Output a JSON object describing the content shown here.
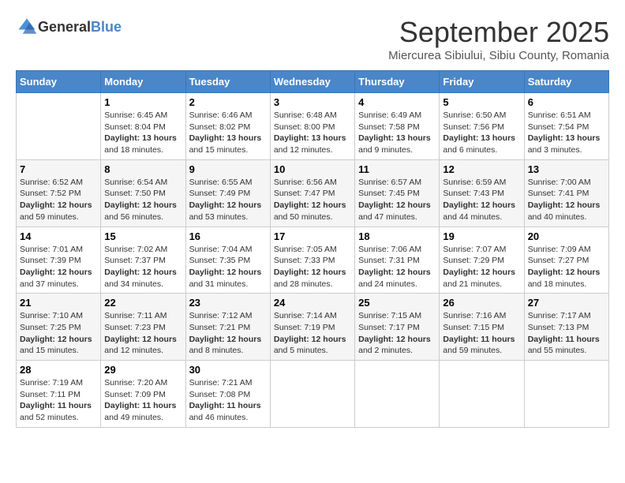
{
  "header": {
    "logo_general": "General",
    "logo_blue": "Blue",
    "month": "September 2025",
    "location": "Miercurea Sibiului, Sibiu County, Romania"
  },
  "weekdays": [
    "Sunday",
    "Monday",
    "Tuesday",
    "Wednesday",
    "Thursday",
    "Friday",
    "Saturday"
  ],
  "weeks": [
    [
      {
        "day": "",
        "info": ""
      },
      {
        "day": "1",
        "info": "Sunrise: 6:45 AM\nSunset: 8:04 PM\nDaylight: 13 hours\nand 18 minutes."
      },
      {
        "day": "2",
        "info": "Sunrise: 6:46 AM\nSunset: 8:02 PM\nDaylight: 13 hours\nand 15 minutes."
      },
      {
        "day": "3",
        "info": "Sunrise: 6:48 AM\nSunset: 8:00 PM\nDaylight: 13 hours\nand 12 minutes."
      },
      {
        "day": "4",
        "info": "Sunrise: 6:49 AM\nSunset: 7:58 PM\nDaylight: 13 hours\nand 9 minutes."
      },
      {
        "day": "5",
        "info": "Sunrise: 6:50 AM\nSunset: 7:56 PM\nDaylight: 13 hours\nand 6 minutes."
      },
      {
        "day": "6",
        "info": "Sunrise: 6:51 AM\nSunset: 7:54 PM\nDaylight: 13 hours\nand 3 minutes."
      }
    ],
    [
      {
        "day": "7",
        "info": "Sunrise: 6:52 AM\nSunset: 7:52 PM\nDaylight: 12 hours\nand 59 minutes."
      },
      {
        "day": "8",
        "info": "Sunrise: 6:54 AM\nSunset: 7:50 PM\nDaylight: 12 hours\nand 56 minutes."
      },
      {
        "day": "9",
        "info": "Sunrise: 6:55 AM\nSunset: 7:49 PM\nDaylight: 12 hours\nand 53 minutes."
      },
      {
        "day": "10",
        "info": "Sunrise: 6:56 AM\nSunset: 7:47 PM\nDaylight: 12 hours\nand 50 minutes."
      },
      {
        "day": "11",
        "info": "Sunrise: 6:57 AM\nSunset: 7:45 PM\nDaylight: 12 hours\nand 47 minutes."
      },
      {
        "day": "12",
        "info": "Sunrise: 6:59 AM\nSunset: 7:43 PM\nDaylight: 12 hours\nand 44 minutes."
      },
      {
        "day": "13",
        "info": "Sunrise: 7:00 AM\nSunset: 7:41 PM\nDaylight: 12 hours\nand 40 minutes."
      }
    ],
    [
      {
        "day": "14",
        "info": "Sunrise: 7:01 AM\nSunset: 7:39 PM\nDaylight: 12 hours\nand 37 minutes."
      },
      {
        "day": "15",
        "info": "Sunrise: 7:02 AM\nSunset: 7:37 PM\nDaylight: 12 hours\nand 34 minutes."
      },
      {
        "day": "16",
        "info": "Sunrise: 7:04 AM\nSunset: 7:35 PM\nDaylight: 12 hours\nand 31 minutes."
      },
      {
        "day": "17",
        "info": "Sunrise: 7:05 AM\nSunset: 7:33 PM\nDaylight: 12 hours\nand 28 minutes."
      },
      {
        "day": "18",
        "info": "Sunrise: 7:06 AM\nSunset: 7:31 PM\nDaylight: 12 hours\nand 24 minutes."
      },
      {
        "day": "19",
        "info": "Sunrise: 7:07 AM\nSunset: 7:29 PM\nDaylight: 12 hours\nand 21 minutes."
      },
      {
        "day": "20",
        "info": "Sunrise: 7:09 AM\nSunset: 7:27 PM\nDaylight: 12 hours\nand 18 minutes."
      }
    ],
    [
      {
        "day": "21",
        "info": "Sunrise: 7:10 AM\nSunset: 7:25 PM\nDaylight: 12 hours\nand 15 minutes."
      },
      {
        "day": "22",
        "info": "Sunrise: 7:11 AM\nSunset: 7:23 PM\nDaylight: 12 hours\nand 12 minutes."
      },
      {
        "day": "23",
        "info": "Sunrise: 7:12 AM\nSunset: 7:21 PM\nDaylight: 12 hours\nand 8 minutes."
      },
      {
        "day": "24",
        "info": "Sunrise: 7:14 AM\nSunset: 7:19 PM\nDaylight: 12 hours\nand 5 minutes."
      },
      {
        "day": "25",
        "info": "Sunrise: 7:15 AM\nSunset: 7:17 PM\nDaylight: 12 hours\nand 2 minutes."
      },
      {
        "day": "26",
        "info": "Sunrise: 7:16 AM\nSunset: 7:15 PM\nDaylight: 11 hours\nand 59 minutes."
      },
      {
        "day": "27",
        "info": "Sunrise: 7:17 AM\nSunset: 7:13 PM\nDaylight: 11 hours\nand 55 minutes."
      }
    ],
    [
      {
        "day": "28",
        "info": "Sunrise: 7:19 AM\nSunset: 7:11 PM\nDaylight: 11 hours\nand 52 minutes."
      },
      {
        "day": "29",
        "info": "Sunrise: 7:20 AM\nSunset: 7:09 PM\nDaylight: 11 hours\nand 49 minutes."
      },
      {
        "day": "30",
        "info": "Sunrise: 7:21 AM\nSunset: 7:08 PM\nDaylight: 11 hours\nand 46 minutes."
      },
      {
        "day": "",
        "info": ""
      },
      {
        "day": "",
        "info": ""
      },
      {
        "day": "",
        "info": ""
      },
      {
        "day": "",
        "info": ""
      }
    ]
  ]
}
